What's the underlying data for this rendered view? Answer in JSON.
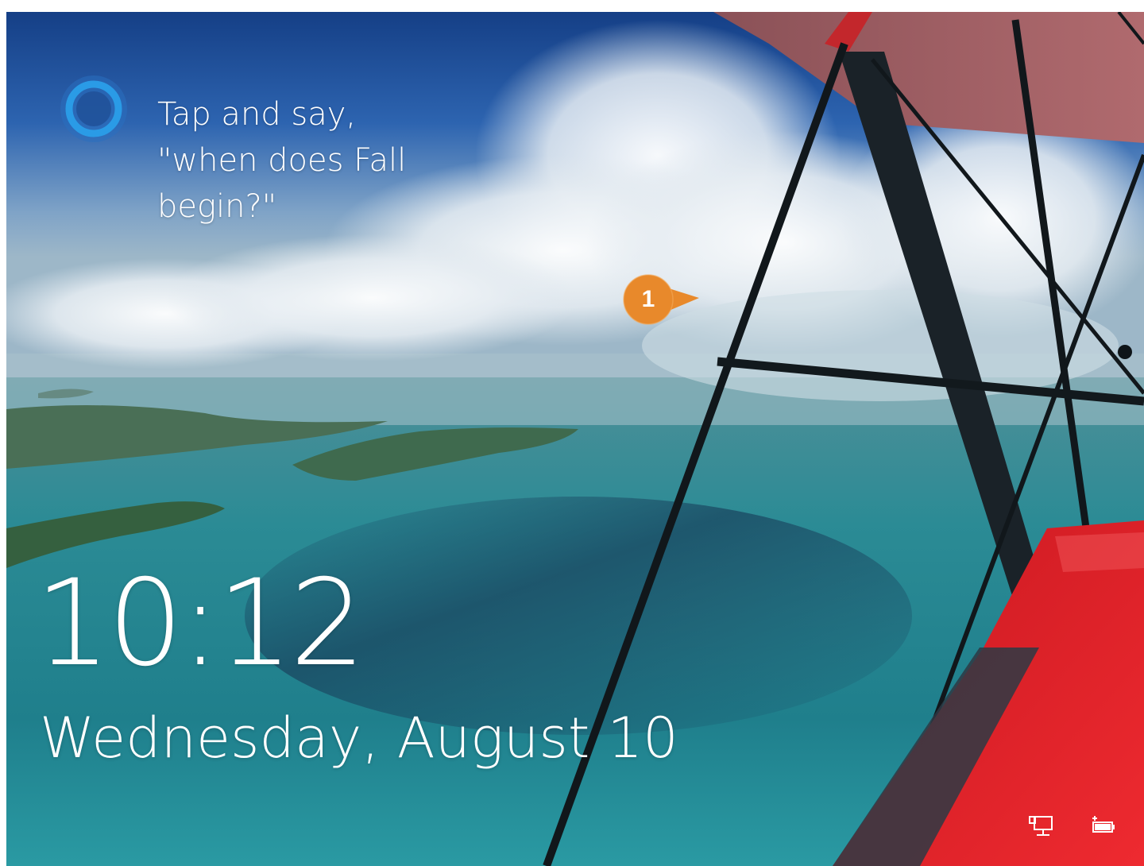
{
  "lock_screen": {
    "cortana_hint": "Tap and say, \"when does Fall begin?\"",
    "time": "10:12",
    "date": "Wednesday, August 10"
  },
  "callout": {
    "number": "1",
    "color": "#e8892b"
  },
  "status_icons": {
    "network": "network-icon",
    "battery": "battery-icon"
  },
  "colors": {
    "sky_top": "#1a4f9c",
    "sea": "#2a8f96",
    "wing_red": "#e0222a",
    "cortana_blue": "#2a86d4"
  }
}
